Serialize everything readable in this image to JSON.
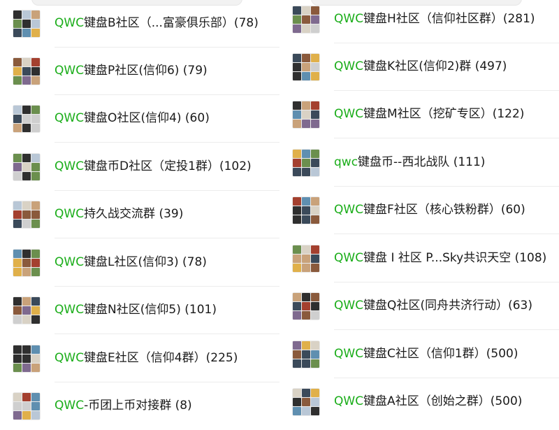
{
  "left_column": [
    {
      "keyword": "QWC",
      "rest": "键盘B社区（...富豪俱乐部）(78)"
    },
    {
      "keyword": "QWC",
      "rest": "键盘P社区(信仰6) (79)"
    },
    {
      "keyword": "QWC",
      "rest": "键盘O社区(信仰4) (60)"
    },
    {
      "keyword": "QWC",
      "rest": "键盘币D社区（定投1群）(102)"
    },
    {
      "keyword": "QWC",
      "rest": "持久战交流群 (39)"
    },
    {
      "keyword": "QWC",
      "rest": "键盘L社区(信仰3) (78)"
    },
    {
      "keyword": "QWC",
      "rest": "键盘N社区(信仰5) (101)"
    },
    {
      "keyword": "QWC",
      "rest": "键盘E社区（信仰4群）(225)"
    },
    {
      "keyword": "QWC",
      "rest": "-币团上币对接群 (8)"
    }
  ],
  "right_column": [
    {
      "keyword": "QWC",
      "rest": "键盘H社区（信仰社区群）(281)"
    },
    {
      "keyword": "QWC",
      "rest": "键盘K社区(信仰2)群 (497)"
    },
    {
      "keyword": "QWC",
      "rest": "键盘M社区（挖矿专区）(122)"
    },
    {
      "keyword": "qwc",
      "rest": "键盘币--西北战队 (111)"
    },
    {
      "keyword": "QWC",
      "rest": "键盘F社区（核心铁粉群）(60)"
    },
    {
      "keyword": "QWC",
      "rest": "键盘 I 社区 P...Sky共识天空 (108)"
    },
    {
      "keyword": "QWC",
      "rest": "键盘Q社区(同舟共济行动）(63)"
    },
    {
      "keyword": "QWC",
      "rest": "键盘C社区（信仰1群）(500)"
    },
    {
      "keyword": "QWC",
      "rest": "键盘A社区（创始之群）(500)"
    }
  ],
  "colors": {
    "keyword_highlight": "#1aad19",
    "text": "#1a1a1a",
    "divider": "#ececec"
  },
  "icons": {
    "avatar": "group-avatar-grid-icon"
  }
}
